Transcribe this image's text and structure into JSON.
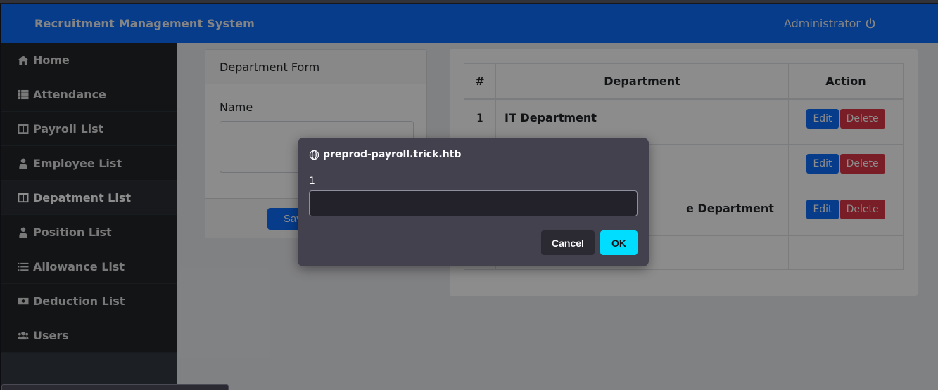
{
  "navbar": {
    "brand": "Recruitment Management System",
    "user": "Administrator",
    "user_icon": "power-icon"
  },
  "sidebar": {
    "items": [
      {
        "label": "Home",
        "icon": "home-icon",
        "active": false
      },
      {
        "label": "Attendance",
        "icon": "th-list-icon",
        "active": false
      },
      {
        "label": "Payroll List",
        "icon": "columns-icon",
        "active": false
      },
      {
        "label": "Employee List",
        "icon": "user-tie-icon",
        "active": false
      },
      {
        "label": "Depatment List",
        "icon": "columns-icon",
        "active": true
      },
      {
        "label": "Position List",
        "icon": "user-tie-icon",
        "active": false
      },
      {
        "label": "Allowance List",
        "icon": "list-icon",
        "active": false
      },
      {
        "label": "Deduction List",
        "icon": "money-bill-icon",
        "active": false
      },
      {
        "label": "Users",
        "icon": "users-icon",
        "active": false
      }
    ]
  },
  "form": {
    "title": "Department Form",
    "name_label": "Name",
    "name_value": "",
    "save_label": "Save"
  },
  "table": {
    "headers": [
      "#",
      "Department",
      "Action"
    ],
    "rows": [
      {
        "num": "1",
        "department": "IT Department",
        "edit": "Edit",
        "delete": "Delete"
      },
      {
        "num": "",
        "department": "",
        "edit": "Edit",
        "delete": "Delete"
      },
      {
        "num": "",
        "department": "e Department",
        "edit": "Edit",
        "delete": "Delete"
      },
      {
        "num": "",
        "department": "",
        "edit": "",
        "delete": ""
      }
    ]
  },
  "dialog": {
    "origin": "preprod-payroll.trick.htb",
    "message": "1",
    "input_value": "",
    "cancel_label": "Cancel",
    "ok_label": "OK"
  },
  "colors": {
    "primary": "#0d6efd",
    "danger": "#dc3545",
    "dialog_ok": "#00ddff",
    "dialog_bg": "#42414d"
  }
}
